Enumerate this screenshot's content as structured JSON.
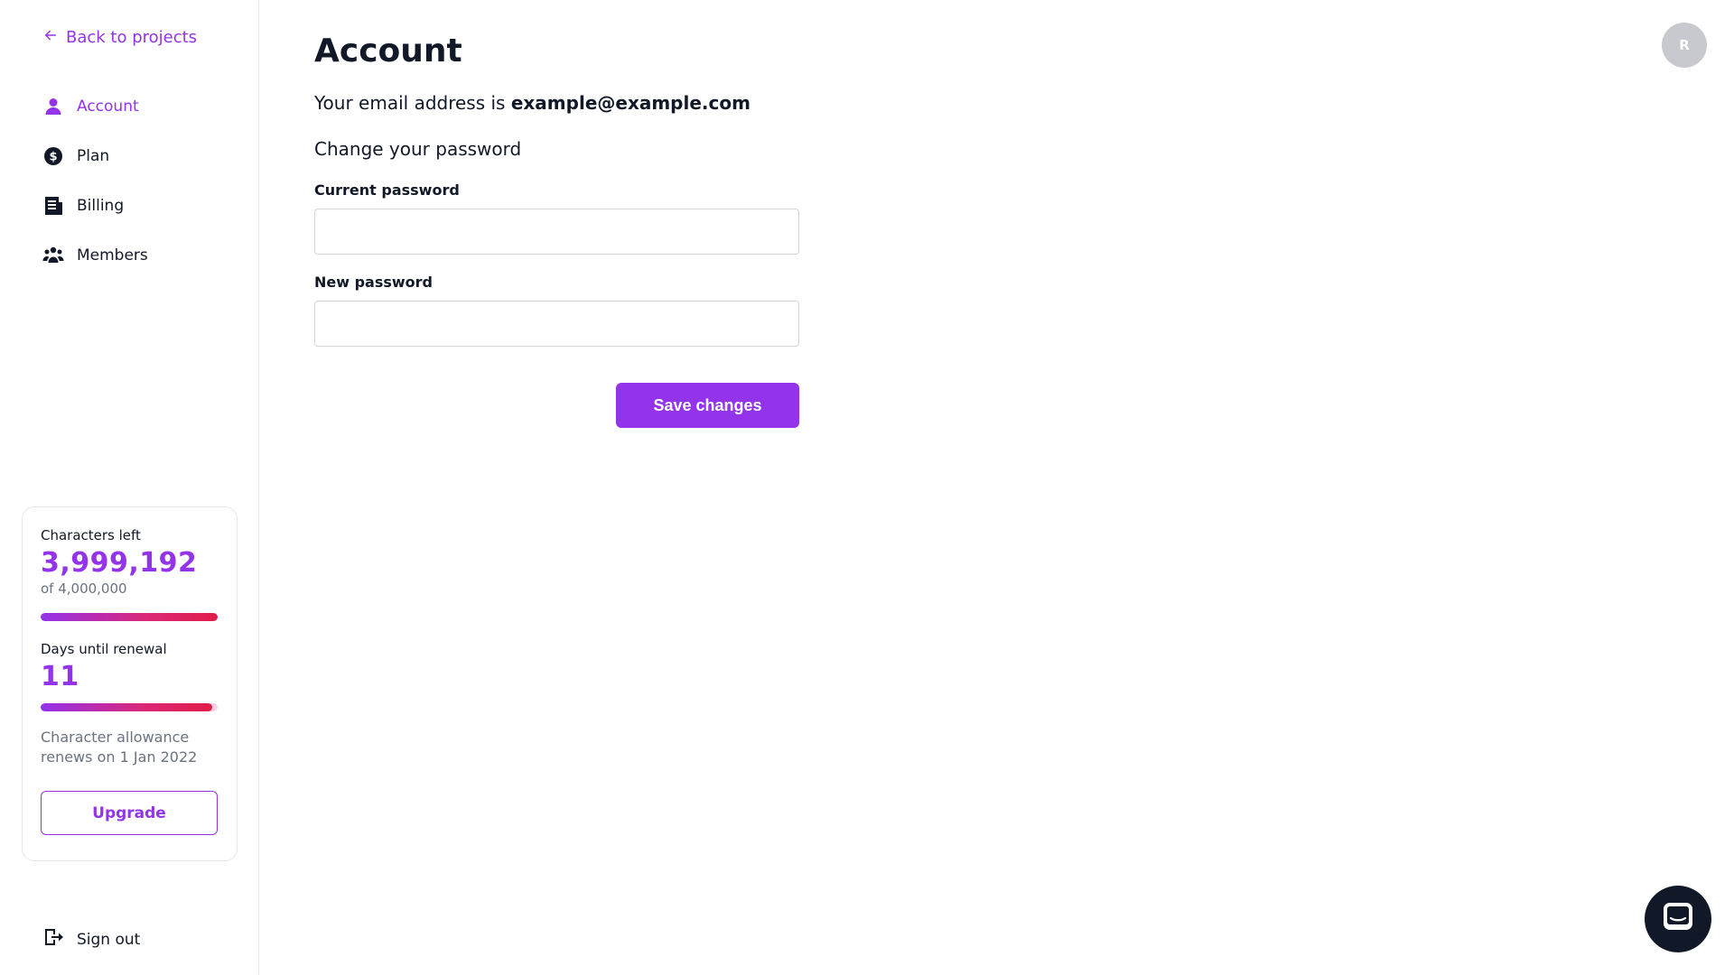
{
  "sidebar": {
    "back_label": "Back to projects",
    "items": [
      {
        "label": "Account",
        "icon": "user-icon",
        "active": true
      },
      {
        "label": "Plan",
        "icon": "dollar-circle-icon",
        "active": false
      },
      {
        "label": "Billing",
        "icon": "receipt-icon",
        "active": false
      },
      {
        "label": "Members",
        "icon": "users-icon",
        "active": false
      }
    ],
    "usage": {
      "characters_label": "Characters left",
      "characters_value": "3,999,192",
      "characters_total": "of 4,000,000",
      "characters_fraction": 0.9998,
      "renewal_label": "Days until renewal",
      "renewal_value": "11",
      "renewal_fraction": 0.97,
      "renew_note": "Character allowance renews on 1 Jan 2022",
      "upgrade_label": "Upgrade"
    },
    "signout_label": "Sign out"
  },
  "main": {
    "title": "Account",
    "email_prefix": "Your email address is ",
    "email": "example@example.com",
    "section_title": "Change your password",
    "current_password_label": "Current password",
    "current_password_value": "",
    "new_password_label": "New password",
    "new_password_value": "",
    "save_label": "Save changes"
  },
  "header": {
    "avatar_initial": "R"
  },
  "colors": {
    "accent": "#9333ea",
    "text": "#111827",
    "muted": "#6b7280",
    "border": "#e5e7eb",
    "avatar_bg": "#c7c9ce",
    "chat_bg": "#111827"
  }
}
